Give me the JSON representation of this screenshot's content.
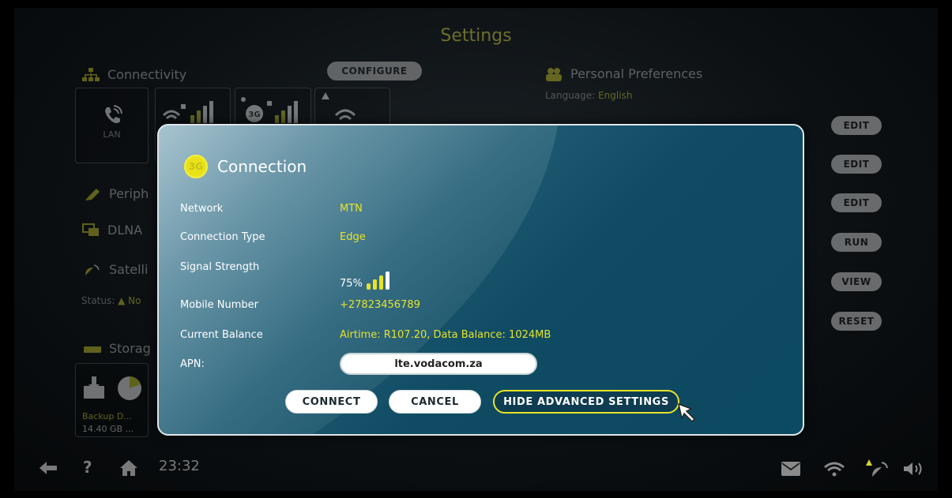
{
  "page": {
    "title": "Settings"
  },
  "background": {
    "connectivity": {
      "heading": "Connectivity",
      "configure_label": "CONFIGURE",
      "lan_label": "LAN",
      "tile_3g_text": "3G"
    },
    "personal": {
      "heading": "Personal Preferences",
      "language_label": "Language:",
      "language_value": "English"
    },
    "sections": {
      "peripherals": "Periph",
      "dlna": "DLNA",
      "satellite": "Satelli",
      "status_label": "Status:",
      "status_value": "No",
      "storage": "Storag"
    },
    "storage_tile": {
      "name": "Backup D...",
      "size": "14.40 GB ..."
    },
    "right_buttons": [
      "EDIT",
      "EDIT",
      "EDIT",
      "RUN",
      "VIEW",
      "RESET"
    ]
  },
  "modal": {
    "badge": "3G",
    "title": "Connection",
    "rows": {
      "network": {
        "label": "Network",
        "value": "MTN"
      },
      "connection_type": {
        "label": "Connection Type",
        "value": "Edge"
      },
      "signal_strength": {
        "label": "Signal Strength",
        "value": "75%",
        "level": 0.75
      },
      "mobile_number": {
        "label": "Mobile Number",
        "value": "+27823456789"
      },
      "current_balance": {
        "label": "Current Balance",
        "value": "Airtime: R107.20, Data Balance: 1024MB"
      },
      "apn": {
        "label": "APN:",
        "value": "lte.vodacom.za"
      }
    },
    "buttons": {
      "connect": "CONNECT",
      "cancel": "CANCEL",
      "advanced": "HIDE ADVANCED SETTINGS"
    }
  },
  "bottom_bar": {
    "clock": "23:32"
  },
  "colors": {
    "accent_yellow": "#e6e32a",
    "modal_blue": "#0f4b63",
    "background": "#0c1013"
  },
  "icons": [
    "back-arrow-icon",
    "help-icon",
    "home-icon",
    "mail-icon",
    "wifi-icon",
    "satellite-warning-icon",
    "volume-icon"
  ]
}
